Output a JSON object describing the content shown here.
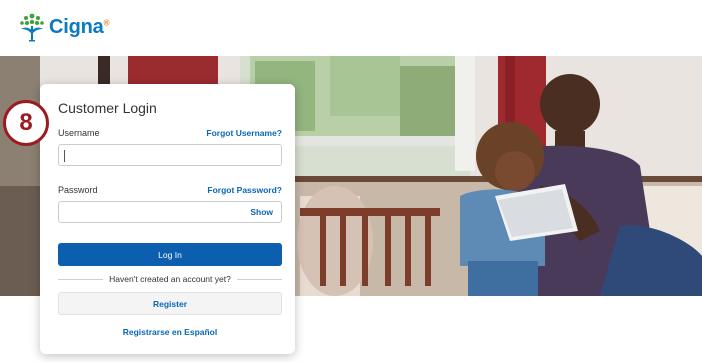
{
  "header": {
    "brand": "Cigna",
    "trademark": "®",
    "brand_color": "#0a7bc1"
  },
  "step_badge": "8",
  "login": {
    "title": "Customer Login",
    "username_label": "Username",
    "forgot_username": "Forgot Username?",
    "username_value": "",
    "password_label": "Password",
    "forgot_password": "Forgot Password?",
    "password_value": "",
    "show_label": "Show",
    "login_button": "Log In",
    "no_account_text": "Haven't created an account yet?",
    "register_button": "Register",
    "spanish_link": "Registrarse en Español"
  },
  "colors": {
    "primary_button": "#0b5fae",
    "link": "#0a66b8",
    "badge": "#9b1b20"
  }
}
